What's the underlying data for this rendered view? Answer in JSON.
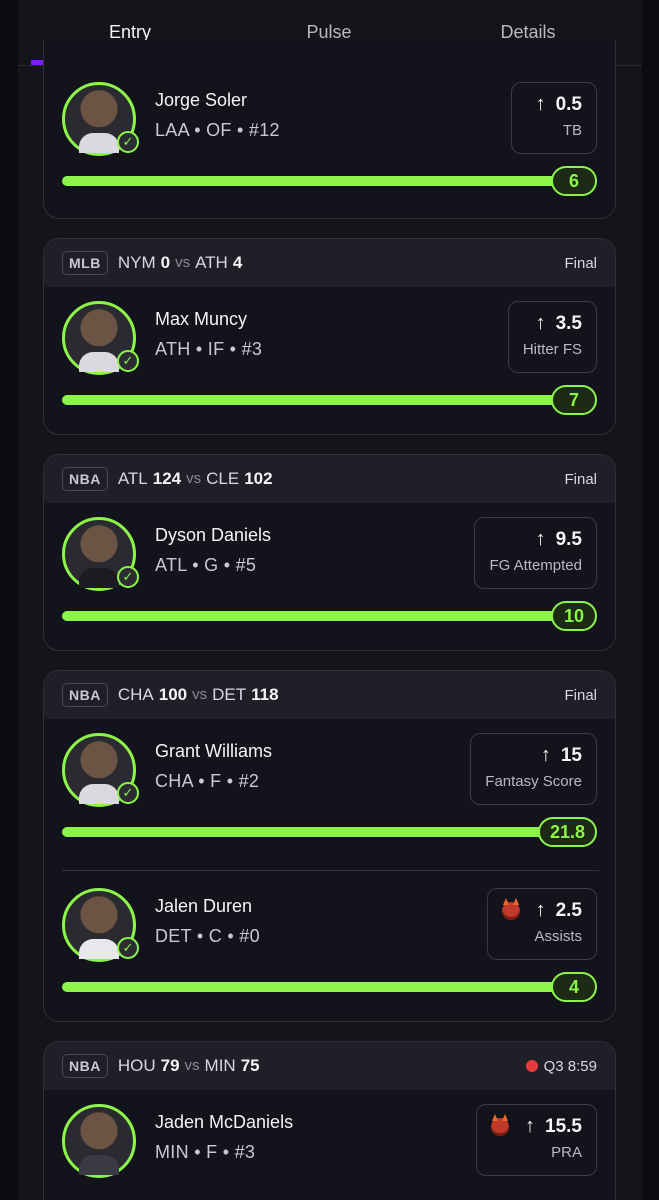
{
  "tabs": [
    {
      "label": "Entry",
      "active": true
    },
    {
      "label": "Pulse",
      "active": false
    },
    {
      "label": "Details",
      "active": false
    }
  ],
  "accent": "#8df54a",
  "tab_accent": "#7a1ff0",
  "cards": [
    {
      "players": [
        {
          "name": "Jorge Soler",
          "meta": "LAA • OF • #12",
          "line": "0.5",
          "stat": "TB",
          "result": "6"
        }
      ]
    },
    {
      "league": "MLB",
      "away": "NYM",
      "away_score": "0",
      "vs": "vs",
      "home": "ATH",
      "home_score": "4",
      "status": "Final",
      "players": [
        {
          "name": "Max Muncy",
          "meta": "ATH • IF • #3",
          "line": "3.5",
          "stat": "Hitter FS",
          "result": "7"
        }
      ]
    },
    {
      "league": "NBA",
      "away": "ATL",
      "away_score": "124",
      "vs": "vs",
      "home": "CLE",
      "home_score": "102",
      "status": "Final",
      "players": [
        {
          "name": "Dyson Daniels",
          "meta": "ATL • G • #5",
          "line": "9.5",
          "stat": "FG Attempted",
          "result": "10"
        }
      ]
    },
    {
      "league": "NBA",
      "away": "CHA",
      "away_score": "100",
      "vs": "vs",
      "home": "DET",
      "home_score": "118",
      "status": "Final",
      "players": [
        {
          "name": "Grant Williams",
          "meta": "CHA • F • #2",
          "line": "15",
          "stat": "Fantasy Score",
          "result": "21.8"
        },
        {
          "name": "Jalen Duren",
          "meta": "DET • C • #0",
          "line": "2.5",
          "stat": "Assists",
          "result": "4",
          "demon": true
        }
      ]
    },
    {
      "league": "NBA",
      "away": "HOU",
      "away_score": "79",
      "vs": "vs",
      "home": "MIN",
      "home_score": "75",
      "status": "Q3 8:59",
      "live": true,
      "players": [
        {
          "name": "Jaden McDaniels",
          "meta": "MIN • F • #3",
          "line": "15.5",
          "stat": "PRA",
          "result": "",
          "demon": true
        }
      ]
    }
  ]
}
